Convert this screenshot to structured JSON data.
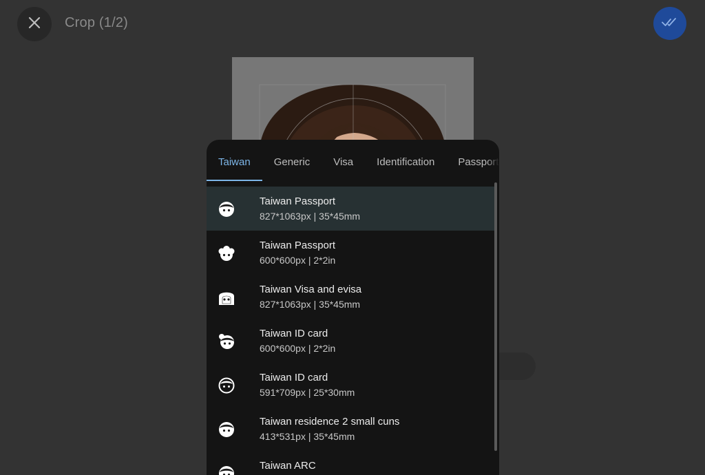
{
  "header": {
    "title": "Crop (1/2)",
    "close_icon": "close-icon",
    "confirm_icon": "double-check-icon",
    "accent": "#1f4a9a"
  },
  "tabs": [
    {
      "label": "Taiwan",
      "active": true
    },
    {
      "label": "Generic",
      "active": false
    },
    {
      "label": "Visa",
      "active": false
    },
    {
      "label": "Identification",
      "active": false
    },
    {
      "label": "Passport",
      "active": false
    }
  ],
  "tab_accent": "#7db6e8",
  "items": [
    {
      "name": "Taiwan Passport",
      "spec": "827*1063px | 35*45mm",
      "icon": "face-icon",
      "selected": true
    },
    {
      "name": "Taiwan Passport",
      "spec": "600*600px | 2*2in",
      "icon": "face-curly-hair-icon",
      "selected": false
    },
    {
      "name": "Taiwan Visa and evisa",
      "spec": "827*1063px | 35*45mm",
      "icon": "face-long-hair-icon",
      "selected": false
    },
    {
      "name": "Taiwan ID card",
      "spec": "600*600px | 2*2in",
      "icon": "face-bun-hair-icon",
      "selected": false
    },
    {
      "name": "Taiwan ID card",
      "spec": "591*709px | 25*30mm",
      "icon": "face-icon",
      "selected": false
    },
    {
      "name": "Taiwan residence 2 small cuns",
      "spec": "413*531px | 35*45mm",
      "icon": "face-icon",
      "selected": false
    },
    {
      "name": "Taiwan ARC",
      "spec": "",
      "icon": "face-icon",
      "selected": false
    }
  ]
}
